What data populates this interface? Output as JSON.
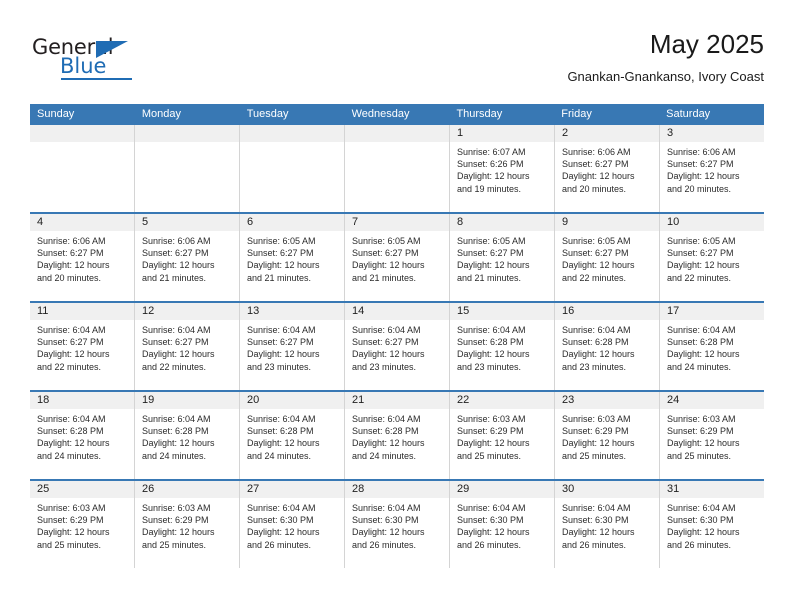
{
  "brand": {
    "name_top": "General",
    "name_bottom": "Blue",
    "accent_color": "#1f6cb4",
    "triangle_icon": "triangle-icon"
  },
  "header": {
    "title": "May 2025",
    "subtitle": "Gnankan-Gnankanso, Ivory Coast"
  },
  "calendar": {
    "header_bg": "#3878b4",
    "day_header_bg": "#f0f0f0",
    "weekdays": [
      "Sunday",
      "Monday",
      "Tuesday",
      "Wednesday",
      "Thursday",
      "Friday",
      "Saturday"
    ],
    "weeks": [
      [
        {
          "date": "",
          "sunrise": "",
          "sunset": "",
          "daylight_line1": "",
          "daylight_line2": ""
        },
        {
          "date": "",
          "sunrise": "",
          "sunset": "",
          "daylight_line1": "",
          "daylight_line2": ""
        },
        {
          "date": "",
          "sunrise": "",
          "sunset": "",
          "daylight_line1": "",
          "daylight_line2": ""
        },
        {
          "date": "",
          "sunrise": "",
          "sunset": "",
          "daylight_line1": "",
          "daylight_line2": ""
        },
        {
          "date": "1",
          "sunrise": "Sunrise: 6:07 AM",
          "sunset": "Sunset: 6:26 PM",
          "daylight_line1": "Daylight: 12 hours",
          "daylight_line2": "and 19 minutes."
        },
        {
          "date": "2",
          "sunrise": "Sunrise: 6:06 AM",
          "sunset": "Sunset: 6:27 PM",
          "daylight_line1": "Daylight: 12 hours",
          "daylight_line2": "and 20 minutes."
        },
        {
          "date": "3",
          "sunrise": "Sunrise: 6:06 AM",
          "sunset": "Sunset: 6:27 PM",
          "daylight_line1": "Daylight: 12 hours",
          "daylight_line2": "and 20 minutes."
        }
      ],
      [
        {
          "date": "4",
          "sunrise": "Sunrise: 6:06 AM",
          "sunset": "Sunset: 6:27 PM",
          "daylight_line1": "Daylight: 12 hours",
          "daylight_line2": "and 20 minutes."
        },
        {
          "date": "5",
          "sunrise": "Sunrise: 6:06 AM",
          "sunset": "Sunset: 6:27 PM",
          "daylight_line1": "Daylight: 12 hours",
          "daylight_line2": "and 21 minutes."
        },
        {
          "date": "6",
          "sunrise": "Sunrise: 6:05 AM",
          "sunset": "Sunset: 6:27 PM",
          "daylight_line1": "Daylight: 12 hours",
          "daylight_line2": "and 21 minutes."
        },
        {
          "date": "7",
          "sunrise": "Sunrise: 6:05 AM",
          "sunset": "Sunset: 6:27 PM",
          "daylight_line1": "Daylight: 12 hours",
          "daylight_line2": "and 21 minutes."
        },
        {
          "date": "8",
          "sunrise": "Sunrise: 6:05 AM",
          "sunset": "Sunset: 6:27 PM",
          "daylight_line1": "Daylight: 12 hours",
          "daylight_line2": "and 21 minutes."
        },
        {
          "date": "9",
          "sunrise": "Sunrise: 6:05 AM",
          "sunset": "Sunset: 6:27 PM",
          "daylight_line1": "Daylight: 12 hours",
          "daylight_line2": "and 22 minutes."
        },
        {
          "date": "10",
          "sunrise": "Sunrise: 6:05 AM",
          "sunset": "Sunset: 6:27 PM",
          "daylight_line1": "Daylight: 12 hours",
          "daylight_line2": "and 22 minutes."
        }
      ],
      [
        {
          "date": "11",
          "sunrise": "Sunrise: 6:04 AM",
          "sunset": "Sunset: 6:27 PM",
          "daylight_line1": "Daylight: 12 hours",
          "daylight_line2": "and 22 minutes."
        },
        {
          "date": "12",
          "sunrise": "Sunrise: 6:04 AM",
          "sunset": "Sunset: 6:27 PM",
          "daylight_line1": "Daylight: 12 hours",
          "daylight_line2": "and 22 minutes."
        },
        {
          "date": "13",
          "sunrise": "Sunrise: 6:04 AM",
          "sunset": "Sunset: 6:27 PM",
          "daylight_line1": "Daylight: 12 hours",
          "daylight_line2": "and 23 minutes."
        },
        {
          "date": "14",
          "sunrise": "Sunrise: 6:04 AM",
          "sunset": "Sunset: 6:27 PM",
          "daylight_line1": "Daylight: 12 hours",
          "daylight_line2": "and 23 minutes."
        },
        {
          "date": "15",
          "sunrise": "Sunrise: 6:04 AM",
          "sunset": "Sunset: 6:28 PM",
          "daylight_line1": "Daylight: 12 hours",
          "daylight_line2": "and 23 minutes."
        },
        {
          "date": "16",
          "sunrise": "Sunrise: 6:04 AM",
          "sunset": "Sunset: 6:28 PM",
          "daylight_line1": "Daylight: 12 hours",
          "daylight_line2": "and 23 minutes."
        },
        {
          "date": "17",
          "sunrise": "Sunrise: 6:04 AM",
          "sunset": "Sunset: 6:28 PM",
          "daylight_line1": "Daylight: 12 hours",
          "daylight_line2": "and 24 minutes."
        }
      ],
      [
        {
          "date": "18",
          "sunrise": "Sunrise: 6:04 AM",
          "sunset": "Sunset: 6:28 PM",
          "daylight_line1": "Daylight: 12 hours",
          "daylight_line2": "and 24 minutes."
        },
        {
          "date": "19",
          "sunrise": "Sunrise: 6:04 AM",
          "sunset": "Sunset: 6:28 PM",
          "daylight_line1": "Daylight: 12 hours",
          "daylight_line2": "and 24 minutes."
        },
        {
          "date": "20",
          "sunrise": "Sunrise: 6:04 AM",
          "sunset": "Sunset: 6:28 PM",
          "daylight_line1": "Daylight: 12 hours",
          "daylight_line2": "and 24 minutes."
        },
        {
          "date": "21",
          "sunrise": "Sunrise: 6:04 AM",
          "sunset": "Sunset: 6:28 PM",
          "daylight_line1": "Daylight: 12 hours",
          "daylight_line2": "and 24 minutes."
        },
        {
          "date": "22",
          "sunrise": "Sunrise: 6:03 AM",
          "sunset": "Sunset: 6:29 PM",
          "daylight_line1": "Daylight: 12 hours",
          "daylight_line2": "and 25 minutes."
        },
        {
          "date": "23",
          "sunrise": "Sunrise: 6:03 AM",
          "sunset": "Sunset: 6:29 PM",
          "daylight_line1": "Daylight: 12 hours",
          "daylight_line2": "and 25 minutes."
        },
        {
          "date": "24",
          "sunrise": "Sunrise: 6:03 AM",
          "sunset": "Sunset: 6:29 PM",
          "daylight_line1": "Daylight: 12 hours",
          "daylight_line2": "and 25 minutes."
        }
      ],
      [
        {
          "date": "25",
          "sunrise": "Sunrise: 6:03 AM",
          "sunset": "Sunset: 6:29 PM",
          "daylight_line1": "Daylight: 12 hours",
          "daylight_line2": "and 25 minutes."
        },
        {
          "date": "26",
          "sunrise": "Sunrise: 6:03 AM",
          "sunset": "Sunset: 6:29 PM",
          "daylight_line1": "Daylight: 12 hours",
          "daylight_line2": "and 25 minutes."
        },
        {
          "date": "27",
          "sunrise": "Sunrise: 6:04 AM",
          "sunset": "Sunset: 6:30 PM",
          "daylight_line1": "Daylight: 12 hours",
          "daylight_line2": "and 26 minutes."
        },
        {
          "date": "28",
          "sunrise": "Sunrise: 6:04 AM",
          "sunset": "Sunset: 6:30 PM",
          "daylight_line1": "Daylight: 12 hours",
          "daylight_line2": "and 26 minutes."
        },
        {
          "date": "29",
          "sunrise": "Sunrise: 6:04 AM",
          "sunset": "Sunset: 6:30 PM",
          "daylight_line1": "Daylight: 12 hours",
          "daylight_line2": "and 26 minutes."
        },
        {
          "date": "30",
          "sunrise": "Sunrise: 6:04 AM",
          "sunset": "Sunset: 6:30 PM",
          "daylight_line1": "Daylight: 12 hours",
          "daylight_line2": "and 26 minutes."
        },
        {
          "date": "31",
          "sunrise": "Sunrise: 6:04 AM",
          "sunset": "Sunset: 6:30 PM",
          "daylight_line1": "Daylight: 12 hours",
          "daylight_line2": "and 26 minutes."
        }
      ]
    ]
  }
}
